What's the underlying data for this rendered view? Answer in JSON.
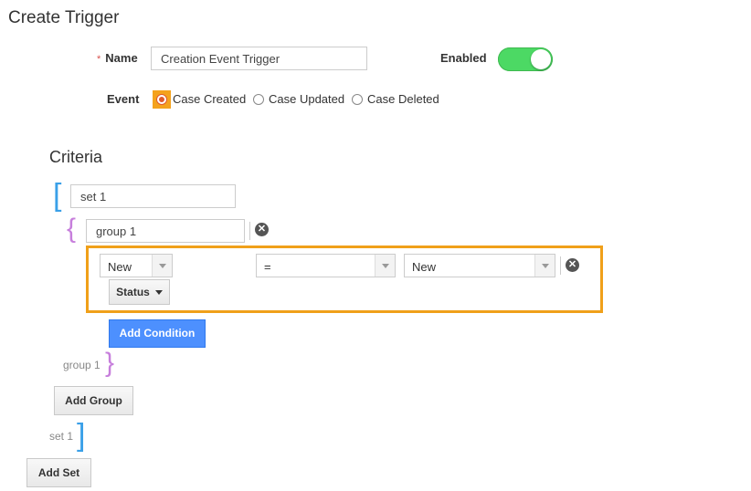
{
  "page": {
    "title": "Create Trigger"
  },
  "form": {
    "name_label": "Name",
    "required_mark": "*",
    "name_value": "Creation Event Trigger",
    "enabled_label": "Enabled",
    "enabled_state": true,
    "event_label": "Event",
    "event_options": [
      "Case Created",
      "Case Updated",
      "Case Deleted"
    ],
    "event_selected": "Case Created"
  },
  "criteria": {
    "title": "Criteria",
    "set_name": "set 1",
    "group_name": "group 1",
    "condition": {
      "field_value": "New",
      "operator_value": "=",
      "value_value": "New",
      "field_type_label": "Status"
    },
    "add_condition_label": "Add Condition",
    "group_footer_label": "group 1",
    "add_group_label": "Add Group",
    "set_footer_label": "set 1",
    "add_set_label": "Add Set"
  },
  "colors": {
    "accent_orange": "#f0a01a",
    "toggle_green": "#4cd964",
    "button_blue": "#4d90fe",
    "bracket_blue": "#3aa0e8",
    "brace_purple": "#c77fdc"
  },
  "icons": {
    "remove_group": "close-circle-icon",
    "remove_condition": "close-circle-icon",
    "select_arrow": "chevron-down-icon"
  }
}
